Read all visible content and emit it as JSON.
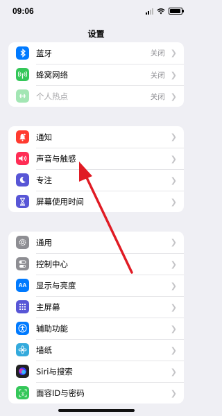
{
  "status_bar": {
    "time": "09:06"
  },
  "nav": {
    "title": "设置"
  },
  "groups": [
    {
      "items": [
        {
          "label": "蓝牙",
          "value": "关闭",
          "icon": "bluetooth-icon",
          "color": "#007aff"
        },
        {
          "label": "蜂窝网络",
          "value": "关闭",
          "icon": "antenna-icon",
          "color": "#34c759"
        },
        {
          "label": "个人热点",
          "value": "关闭",
          "icon": "hotspot-icon",
          "color": "#34c759",
          "disabled": true
        }
      ]
    },
    {
      "items": [
        {
          "label": "通知",
          "icon": "bell-icon",
          "color": "#ff3b30"
        },
        {
          "label": "声音与触感",
          "icon": "speaker-icon",
          "color": "#ff2d55"
        },
        {
          "label": "专注",
          "icon": "moon-icon",
          "color": "#5856d6"
        },
        {
          "label": "屏幕使用时间",
          "icon": "hourglass-icon",
          "color": "#5856d6"
        }
      ]
    },
    {
      "items": [
        {
          "label": "通用",
          "icon": "gear-icon",
          "color": "#8e8e93"
        },
        {
          "label": "控制中心",
          "icon": "toggles-icon",
          "color": "#8e8e93"
        },
        {
          "label": "显示与亮度",
          "icon": "aa-icon",
          "color": "#007aff",
          "glyph": "AA"
        },
        {
          "label": "主屏幕",
          "icon": "grid-icon",
          "color": "#5856d6"
        },
        {
          "label": "辅助功能",
          "icon": "accessibility-icon",
          "color": "#007aff"
        },
        {
          "label": "墙纸",
          "icon": "flower-icon",
          "color": "#34aadc"
        },
        {
          "label": "Siri与搜索",
          "icon": "siri-icon",
          "color": "#222222"
        },
        {
          "label": "面容ID与密码",
          "icon": "faceid-icon",
          "color": "#34c759"
        }
      ]
    }
  ]
}
